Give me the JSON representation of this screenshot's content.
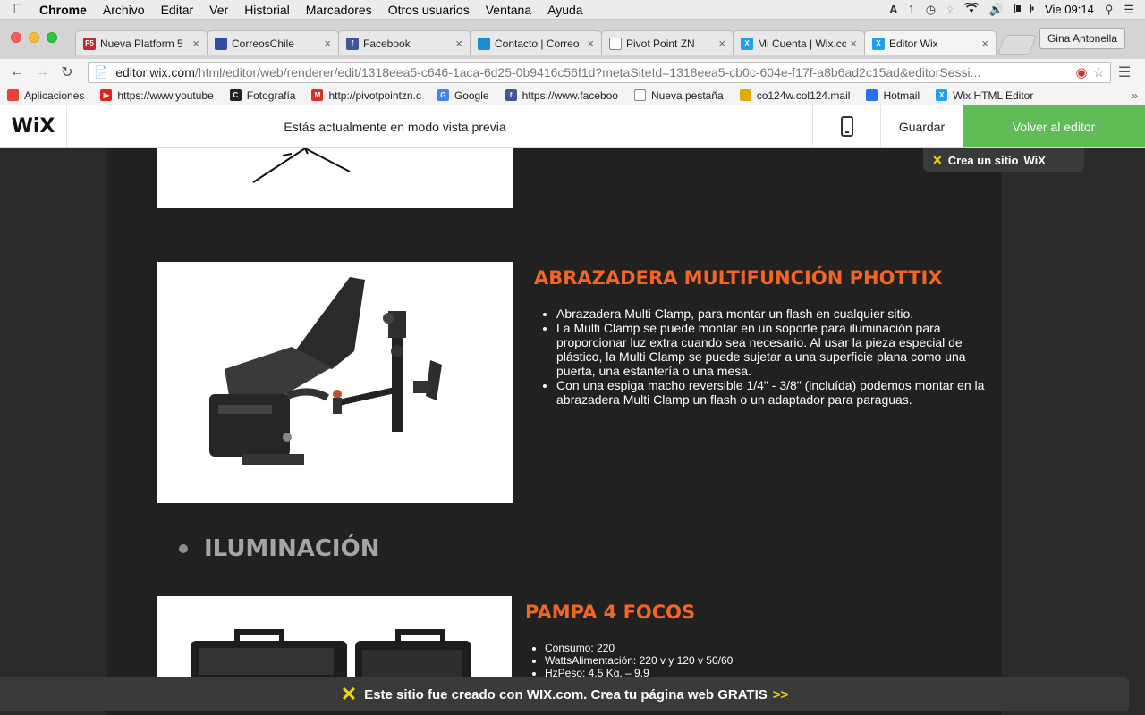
{
  "menubar": {
    "app": "Chrome",
    "items": [
      "Archivo",
      "Editar",
      "Ver",
      "Historial",
      "Marcadores",
      "Otros usuarios",
      "Ventana",
      "Ayuda"
    ],
    "status": {
      "input_indicator": "A",
      "notif_count": "1",
      "clock": "Vie 09:14"
    }
  },
  "tabs": [
    {
      "title": "Nueva Platform 5",
      "icon": "p5-icon",
      "color": "#c1272d",
      "fav": "P5"
    },
    {
      "title": "CorreosChile",
      "icon": "correos-icon",
      "color": "#2b4fa2",
      "fav": ""
    },
    {
      "title": "Facebook",
      "icon": "facebook-icon",
      "color": "#3b5998",
      "fav": "f"
    },
    {
      "title": "Contacto | Correo",
      "icon": "correo-icon",
      "color": "#1a8fd6",
      "fav": ""
    },
    {
      "title": "Pivot Point ZN",
      "icon": "page-icon",
      "color": "#ffffff",
      "fav": ""
    },
    {
      "title": "Mi Cuenta | Wix.co",
      "icon": "wix-icon",
      "color": "#1e9ff2",
      "fav": "X"
    },
    {
      "title": "Editor Wix",
      "icon": "wix-icon",
      "color": "#1e9ff2",
      "fav": "X"
    }
  ],
  "profile": "Gina Antonella",
  "omnibox": {
    "host": "editor.wix.com",
    "path": "/html/editor/web/renderer/edit/1318eea5-c646-1aca-6d25-0b9416c56f1d?metaSiteId=1318eea5-cb0c-604e-f17f-a8b6ad2c15ad&editorSessi..."
  },
  "bookmarks": [
    {
      "label": "Aplicaciones",
      "color": "#e94235",
      "fav": ""
    },
    {
      "label": "https://www.youtube",
      "color": "#e62117",
      "fav": "▶"
    },
    {
      "label": "Fotografía",
      "color": "#222222",
      "fav": "C"
    },
    {
      "label": "http://pivotpointzn.c",
      "color": "#d93025",
      "fav": "M"
    },
    {
      "label": "Google",
      "color": "#4285f4",
      "fav": "G"
    },
    {
      "label": "https://www.faceboo",
      "color": "#3b5998",
      "fav": "f"
    },
    {
      "label": "Nueva pestaña",
      "color": "#ffffff",
      "fav": ""
    },
    {
      "label": "co124w.col124.mail",
      "color": "#e0a800",
      "fav": ""
    },
    {
      "label": "Hotmail",
      "color": "#2672ec",
      "fav": ""
    },
    {
      "label": "Wix HTML Editor",
      "color": "#1e9ff2",
      "fav": "X"
    }
  ],
  "wix": {
    "logo": "WiX",
    "message": "Estás actualmente en modo vista previa",
    "save": "Guardar",
    "back": "Volver al editor",
    "badge": "Crea un sitio",
    "badge_brand": "WiX"
  },
  "products": [
    {
      "title": "ABRAZADERA MULTIFUNCIÓN PHOTTIX",
      "bullets": [
        "Abrazadera Multi Clamp, para montar un flash en cualquier sitio.",
        "La Multi Clamp se puede montar en un soporte para iluminación para proporcionar luz extra cuando sea necesario. Al usar la pieza especial de plástico, la Multi Clamp se puede sujetar a una superficie plana como una puerta, una estantería o una mesa.",
        "Con una espiga macho reversible 1/4\" - 3/8\" (incluída) podemos montar en la abrazadera Multi Clamp un flash o un adaptador para paraguas."
      ]
    },
    {
      "title": "PAMPA 4 FOCOS",
      "bullets": [
        "Consumo: 220",
        "WattsAlimentación: 220 v y 120 v 50/60",
        "HzPeso: 4,5 Kg. – 9,9"
      ]
    }
  ],
  "section": "ILUMINACIÓN",
  "footer": {
    "text": "Este sitio fue creado con WIX.com. Crea tu página web GRATIS",
    "arrows": ">>"
  }
}
